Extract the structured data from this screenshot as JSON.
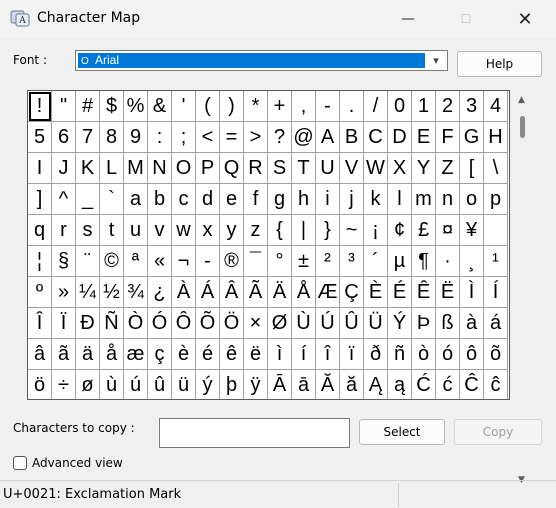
{
  "window": {
    "title": "Character Map",
    "controls": {
      "minimize": "—",
      "maximize": "☐",
      "close": "✕"
    }
  },
  "font": {
    "label": "Font :",
    "selected": "Arial",
    "font_icon": "O"
  },
  "buttons": {
    "help": "Help",
    "select": "Select",
    "copy": "Copy"
  },
  "grid": {
    "selected_index": 0,
    "chars": [
      "!",
      "\"",
      "#",
      "$",
      "%",
      "&",
      "'",
      "(",
      ")",
      "*",
      "+",
      ",",
      "-",
      ".",
      "/",
      "0",
      "1",
      "2",
      "3",
      "4",
      "5",
      "6",
      "7",
      "8",
      "9",
      ":",
      ";",
      "<",
      "=",
      ">",
      "?",
      "@",
      "A",
      "B",
      "C",
      "D",
      "E",
      "F",
      "G",
      "H",
      "I",
      "J",
      "K",
      "L",
      "M",
      "N",
      "O",
      "P",
      "Q",
      "R",
      "S",
      "T",
      "U",
      "V",
      "W",
      "X",
      "Y",
      "Z",
      "[",
      "\\",
      "]",
      "^",
      "_",
      "`",
      "a",
      "b",
      "c",
      "d",
      "e",
      "f",
      "g",
      "h",
      "i",
      "j",
      "k",
      "l",
      "m",
      "n",
      "o",
      "p",
      "q",
      "r",
      "s",
      "t",
      "u",
      "v",
      "w",
      "x",
      "y",
      "z",
      "{",
      "|",
      "}",
      "~",
      "¡",
      "¢",
      "£",
      "¤",
      "¥",
      "",
      "¦",
      "§",
      "¨",
      "©",
      "ª",
      "«",
      "¬",
      "-",
      "®",
      "¯",
      "°",
      "±",
      "²",
      "³",
      "´",
      "µ",
      "¶",
      "·",
      "¸",
      "¹",
      "º",
      "»",
      "¼",
      "½",
      "¾",
      "¿",
      "À",
      "Á",
      "Â",
      "Ã",
      "Ä",
      "Å",
      "Æ",
      "Ç",
      "È",
      "É",
      "Ê",
      "Ë",
      "Ì",
      "Í",
      "Î",
      "Ï",
      "Ð",
      "Ñ",
      "Ò",
      "Ó",
      "Ô",
      "Õ",
      "Ö",
      "×",
      "Ø",
      "Ù",
      "Ú",
      "Û",
      "Ü",
      "Ý",
      "Þ",
      "ß",
      "à",
      "á",
      "â",
      "ã",
      "ä",
      "å",
      "æ",
      "ç",
      "è",
      "é",
      "ê",
      "ë",
      "ì",
      "í",
      "î",
      "ï",
      "ð",
      "ñ",
      "ò",
      "ó",
      "ô",
      "õ",
      "ö",
      "÷",
      "ø",
      "ù",
      "ú",
      "û",
      "ü",
      "ý",
      "þ",
      "ÿ",
      "Ā",
      "ā",
      "Ă",
      "ă",
      "Ą",
      "ą",
      "Ć",
      "ć",
      "Ĉ",
      "ĉ"
    ]
  },
  "copy": {
    "label": "Characters to copy :",
    "value": ""
  },
  "advanced_view": {
    "label": "Advanced view",
    "checked": false
  },
  "status": {
    "text": "U+0021: Exclamation Mark"
  },
  "colors": {
    "selection": "#0078d7",
    "window_bg": "#f0f0f0"
  }
}
